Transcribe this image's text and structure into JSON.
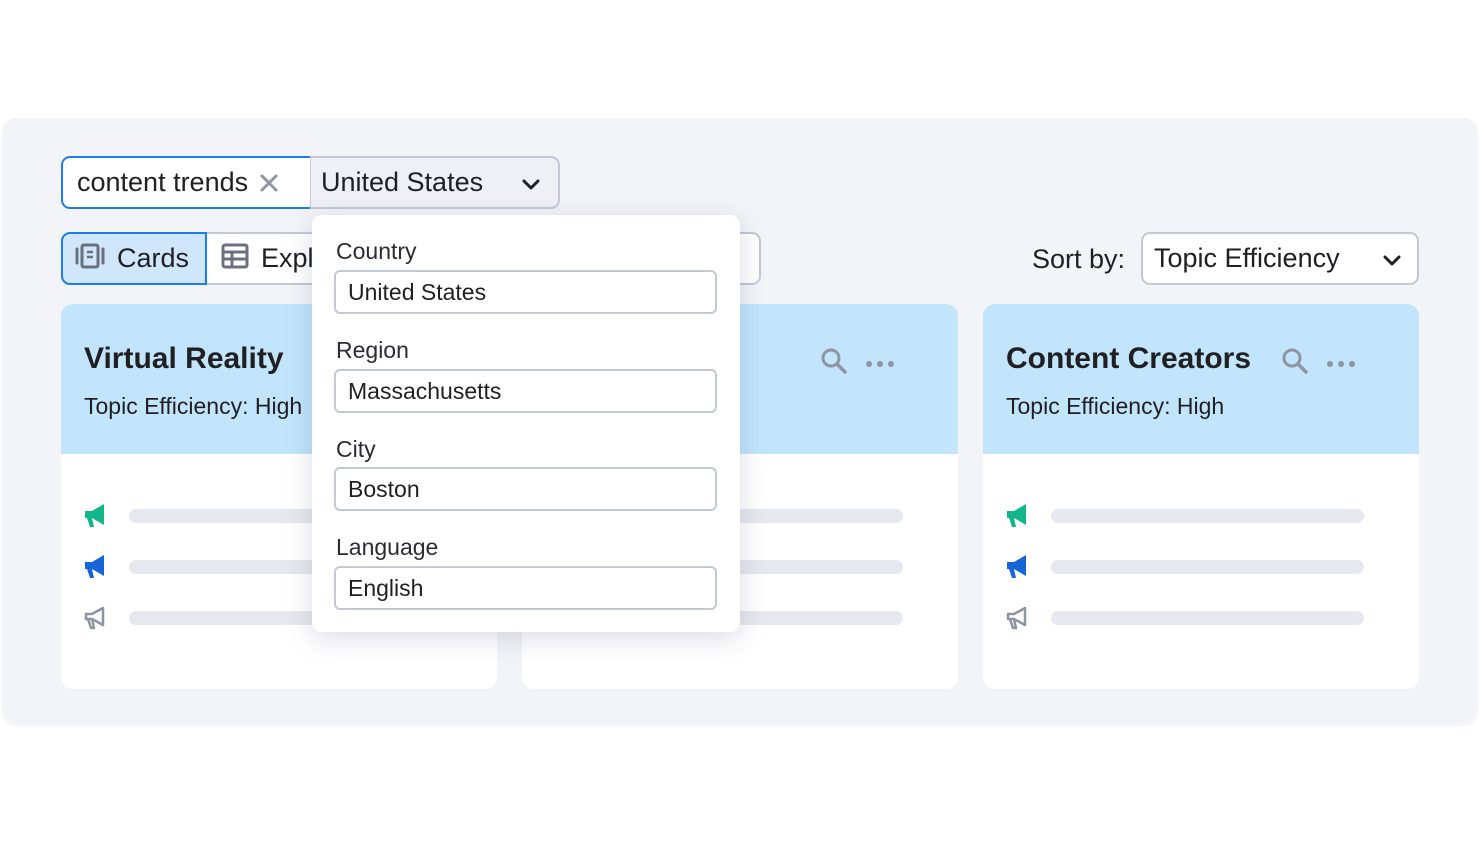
{
  "search": {
    "keyword": "content trends",
    "clear_icon": "close-icon",
    "country": "United States"
  },
  "view": {
    "cards_label": "Cards",
    "explorer_label": "Expl"
  },
  "sort": {
    "label": "Sort by:",
    "value": "Topic Efficiency"
  },
  "cards": [
    {
      "title": "Virtual Reality",
      "subtitle": "Topic Efficiency: High"
    },
    {
      "title": "",
      "subtitle": ""
    },
    {
      "title": "Content Creators",
      "subtitle": "Topic Efficiency: High"
    }
  ],
  "location_dropdown": {
    "country_label": "Country",
    "country_value": "United States",
    "region_label": "Region",
    "region_value": "Massachusetts",
    "city_label": "City",
    "city_value": "Boston",
    "language_label": "Language",
    "language_value": "English"
  },
  "colors": {
    "accent": "#1f7cf0",
    "card_header": "#c2e5fc",
    "megaphone_green": "#14b58a",
    "megaphone_blue": "#1764d6",
    "megaphone_gray": "#8f94a3"
  }
}
